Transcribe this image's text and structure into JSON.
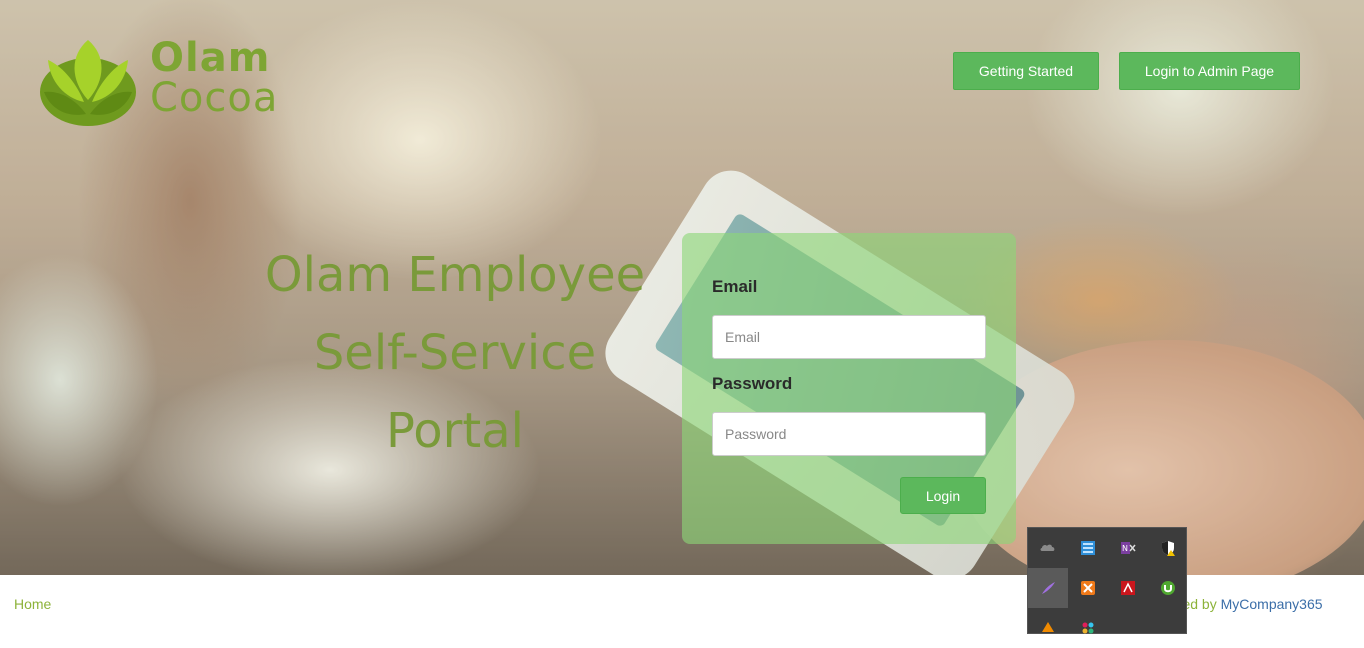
{
  "brand": {
    "name_line1": "Olam",
    "name_line2": "Cocoa"
  },
  "nav": {
    "getting_started_label": "Getting Started",
    "admin_login_label": "Login to Admin Page"
  },
  "hero": {
    "title_line1": "Olam Employee",
    "title_line2": "Self-Service",
    "title_line3": "Portal"
  },
  "login_form": {
    "email_label": "Email",
    "email_placeholder": "Email",
    "email_value": "",
    "password_label": "Password",
    "password_placeholder": "Password",
    "password_value": "",
    "submit_label": "Login"
  },
  "footer": {
    "home_link": "Home",
    "powered_prefix": "ered by",
    "powered_link": "MyCompany365"
  },
  "tray": {
    "icons": [
      "onedrive-icon",
      "network-icon",
      "onenote-clipper-icon",
      "security-shield-icon",
      "feather-pen-icon",
      "xampp-icon",
      "adobe-acrobat-icon",
      "utorrent-icon",
      "vlc-icon",
      "slack-icon"
    ]
  },
  "colors": {
    "accent_green": "#5cb85c",
    "brand_green": "#7ea534",
    "title_green": "#7a9a3a",
    "link_blue": "#3b6ea8"
  }
}
